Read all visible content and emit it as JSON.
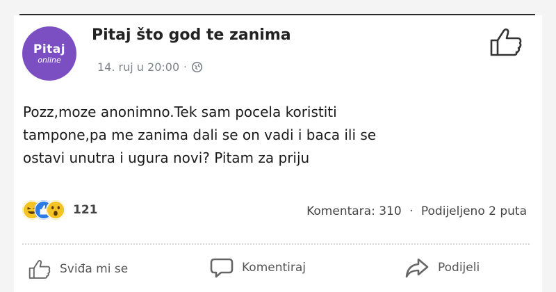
{
  "post": {
    "page_name": "Pitaj što god te zanima",
    "timestamp": "14. ruj u 20:00",
    "meta_separator": "·",
    "avatar_text_top": "Pitaj",
    "avatar_text_bottom": "online",
    "text_lines": [
      "Pozz,moze anonimno.Tek sam pocela koristiti",
      "tampone,pa me zanima dali se on vadi i baca ili se",
      "ostavi unutra i ugura novi? Pitam za priju"
    ]
  },
  "reactions": {
    "icons": [
      "haha-icon",
      "like-icon",
      "wow-icon"
    ],
    "count": "121"
  },
  "stats": {
    "comments": "Komentara: 310",
    "separator": "·",
    "shares": "Podijeljeno 2 puta"
  },
  "actions": {
    "like": "Sviđa mi se",
    "comment": "Komentiraj",
    "share": "Podijeli"
  },
  "colors": {
    "avatar": "#7b4fc2",
    "meta_text": "#7f848a",
    "like_blue": "#2c7be5",
    "emoji_yellow": "#f6c324"
  }
}
